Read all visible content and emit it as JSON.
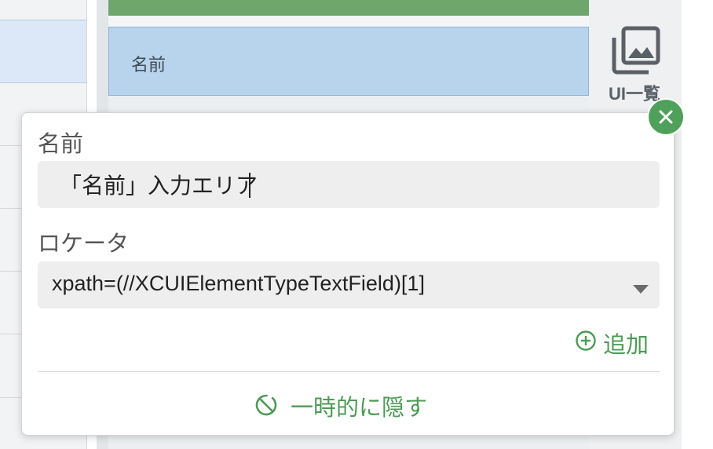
{
  "app": {
    "right_toolbar": {
      "ui_list_label": "UI一覧",
      "icon": "image-gallery-icon"
    },
    "preview": {
      "field_label": "名前"
    }
  },
  "popup": {
    "name_label": "名前",
    "name_value": "「名前」入力エリア",
    "locator_label": "ロケータ",
    "locator_value": "xpath=(//XCUIElementTypeTextField)[1]",
    "add_label": "追加",
    "hide_label": "一時的に隠す",
    "close_icon": "close-icon"
  },
  "colors": {
    "accent_green": "#4e9a57",
    "preview_header_green": "#6fa66b",
    "preview_field_blue": "#b8d4ec",
    "selected_row": "#dce8f7"
  }
}
